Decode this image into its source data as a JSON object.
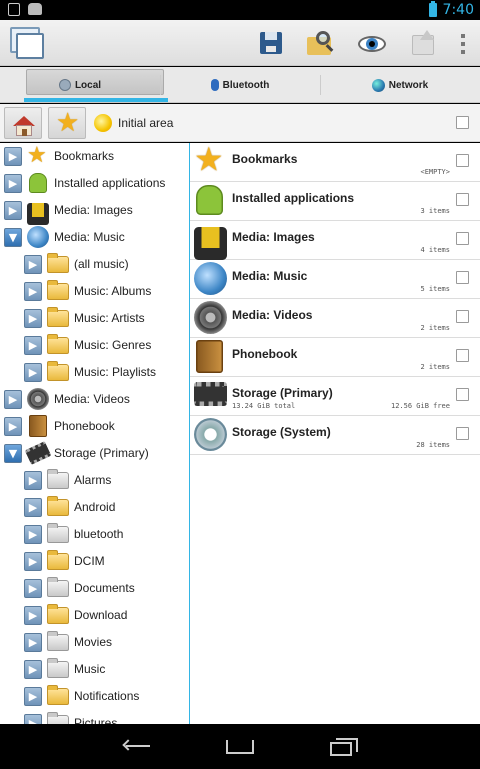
{
  "status_bar": {
    "time": "7:40"
  },
  "action_bar": {
    "app_icon": "windows-icon",
    "actions": [
      "save-icon",
      "search-folder-icon",
      "eye-icon",
      "upload-icon",
      "overflow-menu-icon"
    ]
  },
  "tabs": [
    {
      "label": "Local",
      "icon": "local-drive-icon",
      "active": true
    },
    {
      "label": "Bluetooth",
      "icon": "bluetooth-icon",
      "active": false
    },
    {
      "label": "Network",
      "icon": "globe-icon",
      "active": false
    }
  ],
  "toolbar": {
    "location_label": "Initial area"
  },
  "tree": [
    {
      "label": "Bookmarks",
      "icon": "star-icon",
      "level": 0,
      "expanded": false
    },
    {
      "label": "Installed applications",
      "icon": "android-icon",
      "level": 0,
      "expanded": false
    },
    {
      "label": "Media: Images",
      "icon": "film-icon",
      "level": 0,
      "expanded": false
    },
    {
      "label": "Media: Music",
      "icon": "music-icon",
      "level": 0,
      "expanded": true
    },
    {
      "label": "(all music)",
      "icon": "folder-icon",
      "level": 1,
      "expanded": false
    },
    {
      "label": "Music: Albums",
      "icon": "folder-icon",
      "level": 1,
      "expanded": false
    },
    {
      "label": "Music: Artists",
      "icon": "folder-icon",
      "level": 1,
      "expanded": false
    },
    {
      "label": "Music: Genres",
      "icon": "folder-icon",
      "level": 1,
      "expanded": false
    },
    {
      "label": "Music: Playlists",
      "icon": "folder-icon",
      "level": 1,
      "expanded": false
    },
    {
      "label": "Media: Videos",
      "icon": "video-reel-icon",
      "level": 0,
      "expanded": false
    },
    {
      "label": "Phonebook",
      "icon": "book-icon",
      "level": 0,
      "expanded": false
    },
    {
      "label": "Storage (Primary)",
      "icon": "chip-icon",
      "level": 0,
      "expanded": true
    },
    {
      "label": "Alarms",
      "icon": "folder-gray-icon",
      "level": 1,
      "expanded": false
    },
    {
      "label": "Android",
      "icon": "folder-icon",
      "level": 1,
      "expanded": false
    },
    {
      "label": "bluetooth",
      "icon": "folder-gray-icon",
      "level": 1,
      "expanded": false
    },
    {
      "label": "DCIM",
      "icon": "folder-icon",
      "level": 1,
      "expanded": false
    },
    {
      "label": "Documents",
      "icon": "folder-gray-icon",
      "level": 1,
      "expanded": false
    },
    {
      "label": "Download",
      "icon": "folder-icon",
      "level": 1,
      "expanded": false
    },
    {
      "label": "Movies",
      "icon": "folder-gray-icon",
      "level": 1,
      "expanded": false
    },
    {
      "label": "Music",
      "icon": "folder-gray-icon",
      "level": 1,
      "expanded": false
    },
    {
      "label": "Notifications",
      "icon": "folder-icon",
      "level": 1,
      "expanded": false
    },
    {
      "label": "Pictures",
      "icon": "folder-gray-icon",
      "level": 1,
      "expanded": false
    }
  ],
  "list": [
    {
      "name": "Bookmarks",
      "icon": "star-icon",
      "meta": "<EMPTY>",
      "meta_left": ""
    },
    {
      "name": "Installed applications",
      "icon": "android-icon",
      "meta": "3 items",
      "meta_left": ""
    },
    {
      "name": "Media: Images",
      "icon": "film-icon",
      "meta": "4 items",
      "meta_left": ""
    },
    {
      "name": "Media: Music",
      "icon": "music-icon",
      "meta": "5 items",
      "meta_left": ""
    },
    {
      "name": "Media: Videos",
      "icon": "video-reel-icon",
      "meta": "2 items",
      "meta_left": ""
    },
    {
      "name": "Phonebook",
      "icon": "book-icon",
      "meta": "2 items",
      "meta_left": ""
    },
    {
      "name": "Storage (Primary)",
      "icon": "chip-icon",
      "meta": "12.56 GiB free",
      "meta_left": "13.24 GiB total"
    },
    {
      "name": "Storage (System)",
      "icon": "gear-icon",
      "meta": "28 items",
      "meta_left": ""
    }
  ],
  "colors": {
    "accent": "#33b5e5",
    "folder": "#e9b93c",
    "star": "#f2b01e"
  }
}
